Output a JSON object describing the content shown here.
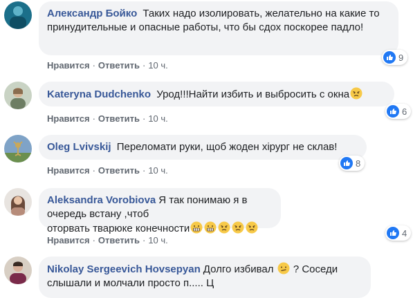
{
  "comments": [
    {
      "author": "Александр Бойко",
      "text": "Таких надо изолировать, желательно на какие то принудительные и опасные работы, что бы сдох поскорее падло!",
      "like_label": "Нравится",
      "reply_label": "Ответить",
      "time": "10 ч.",
      "reaction_count": "9",
      "emojis": [],
      "avatar_colors": [
        "#1b6f8a",
        "#5fb3c9"
      ]
    },
    {
      "author": "Kateryna Dudchenko",
      "text": "Урод!!!Найти избить и выбросить с окна",
      "like_label": "Нравится",
      "reply_label": "Ответить",
      "time": "10 ч.",
      "reaction_count": "6",
      "emojis": [
        "angry-emoji"
      ],
      "avatar_colors": [
        "#c9d3c4",
        "#8a6d4f"
      ]
    },
    {
      "author": "Oleg Lvivskij",
      "text": "Переломати руки, щоб жоден хірург не склав!",
      "like_label": "Нравится",
      "reply_label": "Ответить",
      "time": "10 ч.",
      "reaction_count": "8",
      "emojis": [],
      "avatar_colors": [
        "#7fa3c7",
        "#c9a85a"
      ]
    },
    {
      "author": "Aleksandra Vorobiova",
      "text_line1": "Я так понимаю я в очередь встану ,чтоб",
      "text_line2": "оторвать тварюке конечности",
      "like_label": "Нравится",
      "reply_label": "Ответить",
      "time": "10 ч.",
      "reaction_count": "4",
      "emojis": [
        "grimace-emoji",
        "grimace-emoji",
        "angry-emoji",
        "angry-emoji",
        "angry-emoji"
      ],
      "avatar_colors": [
        "#e8e4e0",
        "#6b4a3a"
      ]
    },
    {
      "author": "Nikolay Sergeevich Hovsepyan",
      "text_line1": "Долго избивал",
      "text_line1b": "? Соседи",
      "text_line2": "слышали и молчали просто п..... Ц",
      "emojis": [
        "confused-emoji"
      ],
      "avatar_colors": [
        "#d8cfc4",
        "#7a2a4a"
      ]
    }
  ],
  "colors": {
    "author": "#385898",
    "bubble": "#f2f3f5",
    "meta": "#606770",
    "like": "#2078f4",
    "emoji": "#f7c948"
  }
}
